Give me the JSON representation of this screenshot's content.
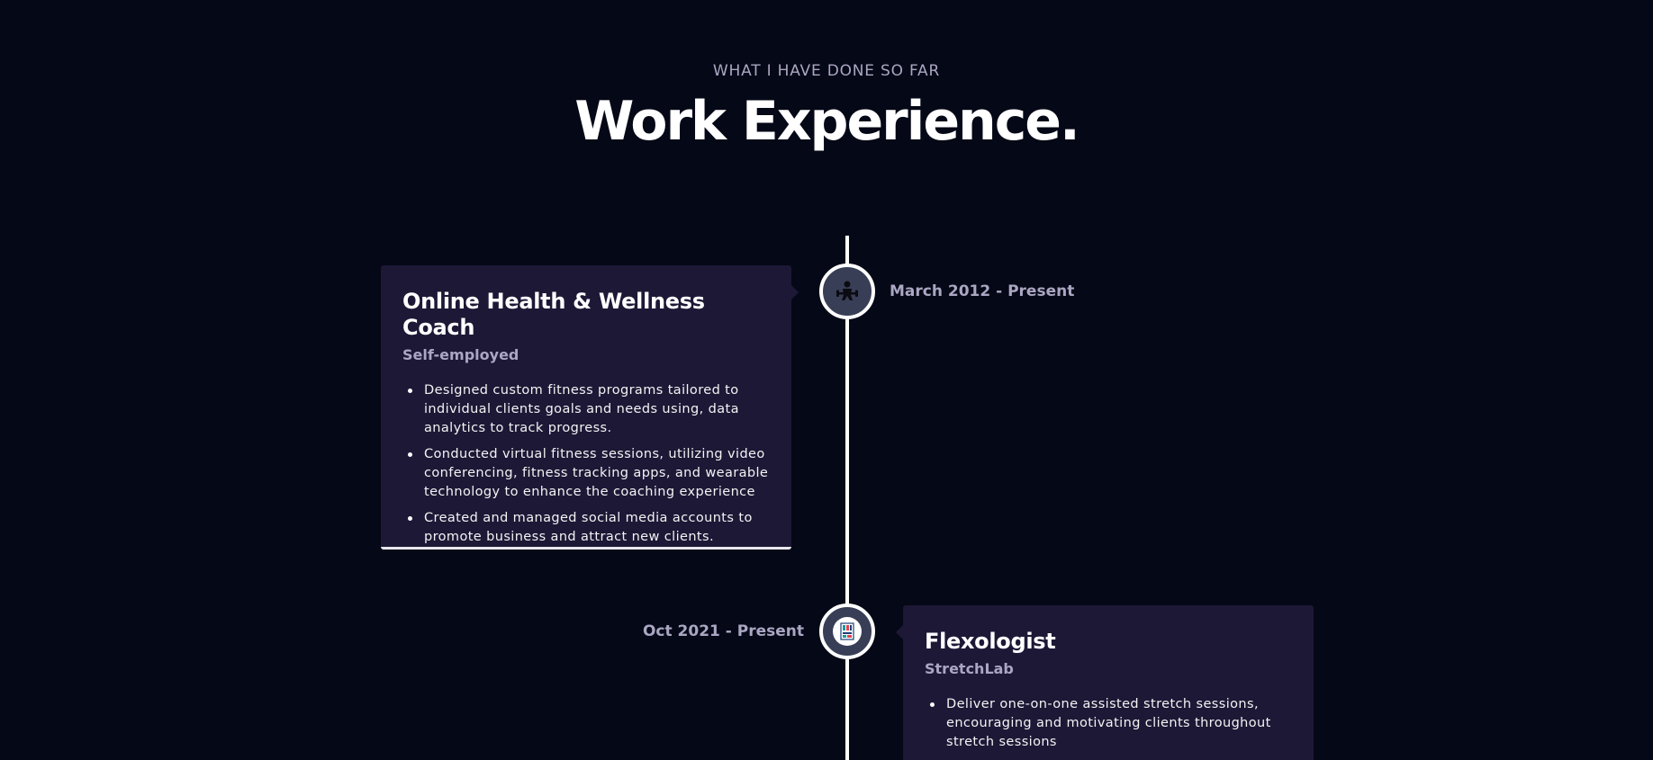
{
  "header": {
    "subtitle": "WHAT I HAVE DONE SO FAR",
    "title": "Work Experience."
  },
  "experiences": [
    {
      "title": "Online Health & Wellness Coach",
      "company": "Self-employed",
      "date": "March 2012 - Present",
      "icon": "fitness-person-icon",
      "points": [
        "Designed custom fitness programs tailored to individual clients goals and needs using, data analytics to track progress.",
        "Conducted virtual fitness sessions, utilizing video conferencing, fitness tracking apps, and wearable technology to enhance the coaching experience",
        "Created and managed social media accounts to promote business and attract new clients."
      ]
    },
    {
      "title": "Flexologist",
      "company": "StretchLab",
      "date": "Oct 2021 - Present",
      "icon": "stretchlab-logo-icon",
      "points": [
        "Deliver one-on-one assisted stretch sessions, encouraging and motivating clients throughout stretch sessions"
      ]
    }
  ],
  "colors": {
    "background": "#050816",
    "card": "#1d1836",
    "secondary_text": "#aaa6c3",
    "node": "#383e56"
  }
}
